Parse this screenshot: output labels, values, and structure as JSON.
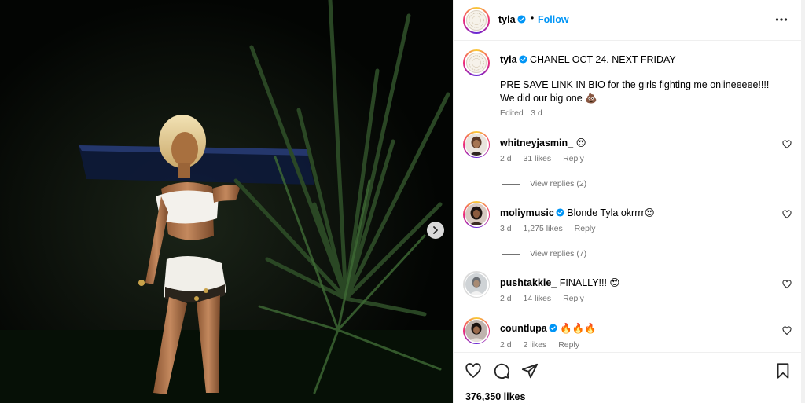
{
  "post": {
    "username": "tyla",
    "follow_label": "Follow",
    "caption": {
      "username": "tyla",
      "line1": "CHANEL OCT 24. NEXT FRIDAY",
      "line2": "PRE SAVE LINK IN BIO for the girls fighting me onlineeeee!!!!",
      "line3": "We did our big one 💩",
      "meta": "Edited · 3 d"
    },
    "comments": [
      {
        "username": "whitneyjasmin_",
        "text": "😍",
        "age": "2 d",
        "likes": "31 likes",
        "reply": "Reply",
        "view_replies": "View replies (2)",
        "verified": false
      },
      {
        "username": "moliymusic",
        "text": "Blonde Tyla okrrrr😍",
        "age": "3 d",
        "likes": "1,275 likes",
        "reply": "Reply",
        "view_replies": "View replies (7)",
        "verified": true
      },
      {
        "username": "pushtakkie_",
        "text": "FINALLY!!! 😍",
        "age": "2 d",
        "likes": "14 likes",
        "reply": "Reply",
        "verified": false
      },
      {
        "username": "countlupa",
        "text": "🔥🔥🔥",
        "age": "2 d",
        "likes": "2 likes",
        "reply": "Reply",
        "verified": true
      }
    ],
    "likes_count": "376,350 likes"
  },
  "colors": {
    "accent": "#0095f6",
    "muted": "#737373",
    "verified": "#0095f6"
  },
  "icons": {
    "like": "heart-icon",
    "comment": "comment-icon",
    "share": "share-icon",
    "save": "bookmark-icon",
    "more": "more-options-icon",
    "next": "chevron-right-icon"
  }
}
